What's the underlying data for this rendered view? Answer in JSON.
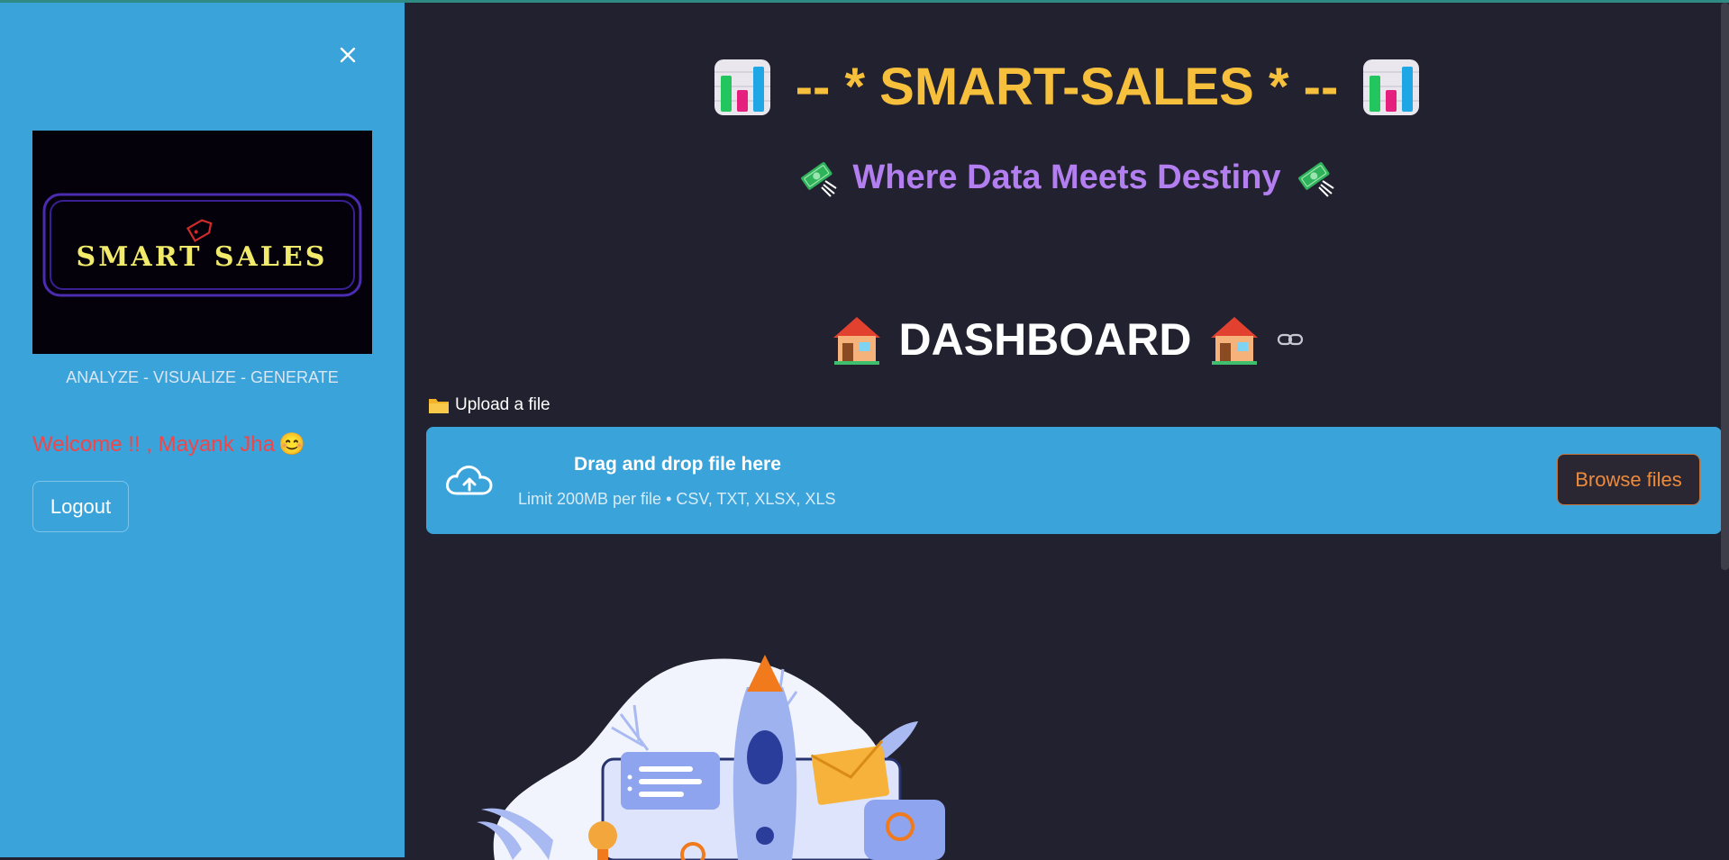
{
  "sidebar": {
    "close_label": "×",
    "logo_text": "SMART SALES",
    "tagline": "ANALYZE - VISUALIZE - GENERATE",
    "welcome": "Welcome !! , Mayank Jha",
    "welcome_emoji": "😊",
    "logout_label": "Logout"
  },
  "main": {
    "title": "-- * SMART-SALES * --",
    "title_icon": "bar-chart-icon",
    "subtitle": "Where Data Meets Destiny",
    "subtitle_icon": "flying-money-icon",
    "dashboard_title": "DASHBOARD",
    "dashboard_icon": "house-icon",
    "anchor_icon": "link-icon",
    "upload": {
      "label": "Upload a file",
      "label_icon": "folder-icon",
      "drop_title": "Drag and drop file here",
      "drop_limit": "Limit 200MB per file • CSV, TXT, XLSX, XLS",
      "browse_label": "Browse files"
    }
  },
  "colors": {
    "sidebar_bg": "#3aa3da",
    "main_bg": "#22212f",
    "title": "#f6bf3c",
    "subtitle": "#b37ff0",
    "welcome": "#f0464a",
    "browse_text": "#ee8a3c"
  }
}
